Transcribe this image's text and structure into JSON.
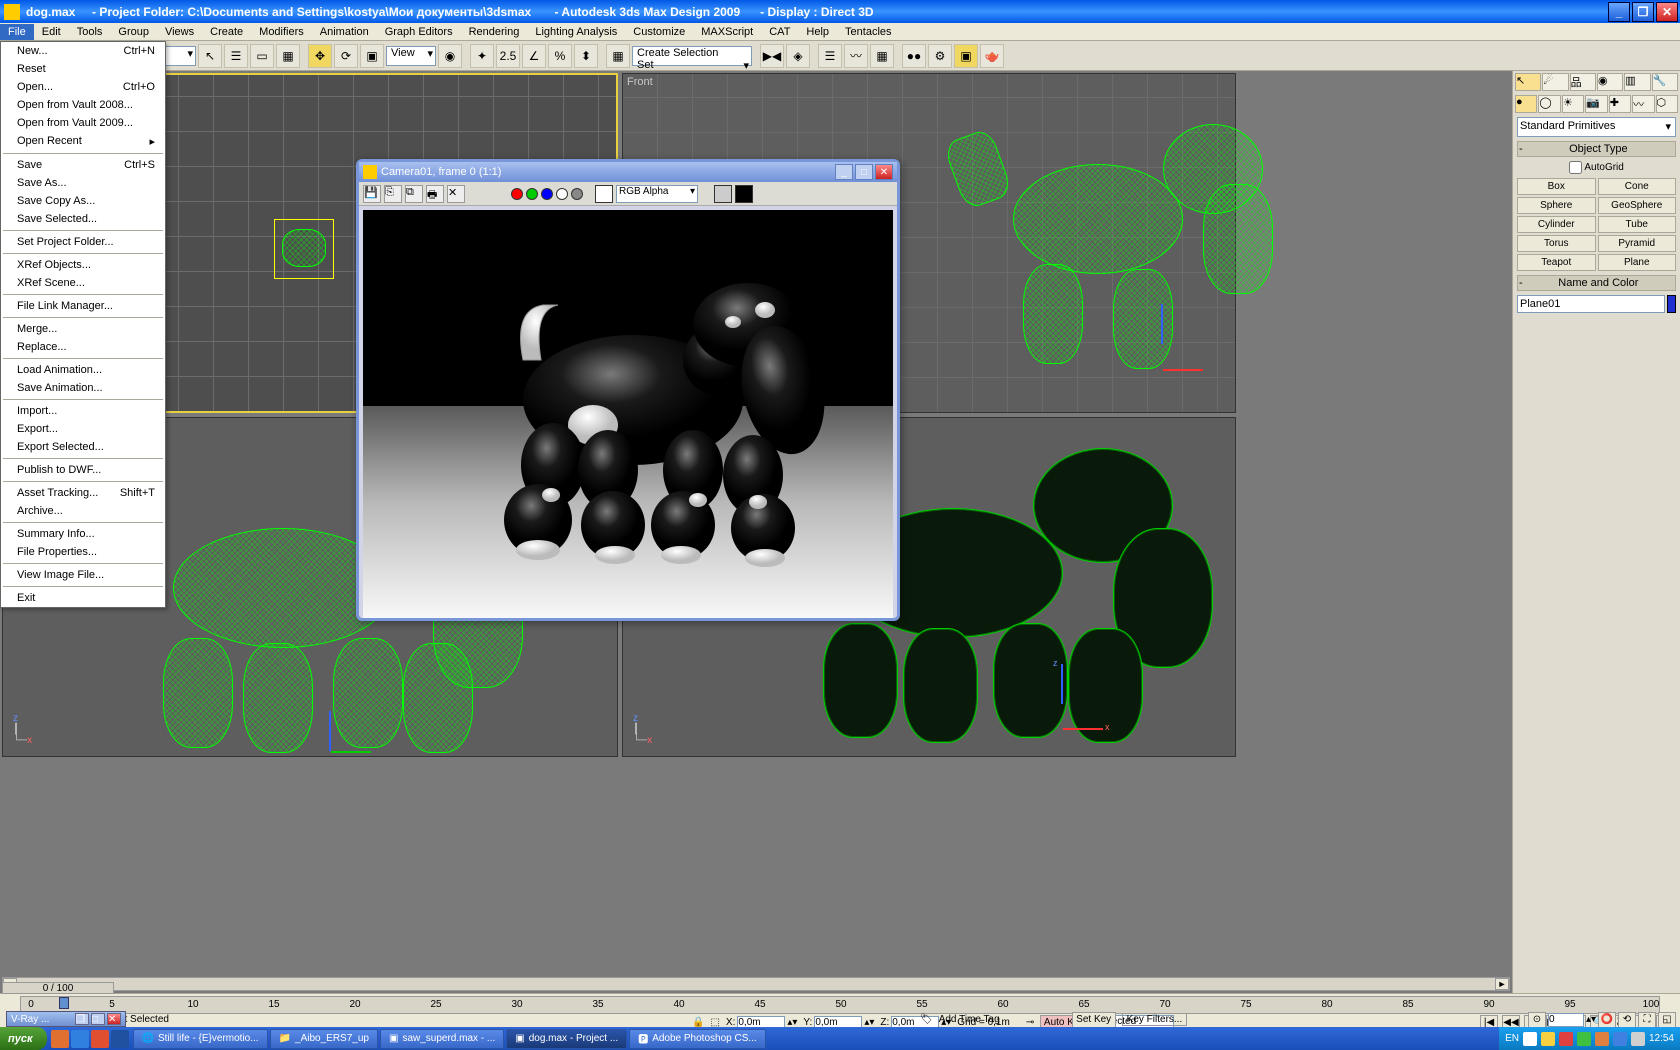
{
  "window": {
    "filename": "dog.max",
    "project_label": "- Project Folder: C:\\Documents and Settings\\kostya\\Мои документы\\3dsmax",
    "app": "- Autodesk 3ds Max Design 2009",
    "display": "- Display : Direct 3D"
  },
  "menubar": [
    "File",
    "Edit",
    "Tools",
    "Group",
    "Views",
    "Create",
    "Modifiers",
    "Animation",
    "Graph Editors",
    "Rendering",
    "Lighting Analysis",
    "Customize",
    "MAXScript",
    "CAT",
    "Help",
    "Tentacles"
  ],
  "file_menu": [
    {
      "label": "New...",
      "accel": "Ctrl+N"
    },
    {
      "label": "Reset"
    },
    {
      "label": "Open...",
      "accel": "Ctrl+O"
    },
    {
      "label": "Open from Vault 2008..."
    },
    {
      "label": "Open from Vault 2009..."
    },
    {
      "label": "Open Recent",
      "sub": true
    },
    {
      "sep": true
    },
    {
      "label": "Save",
      "accel": "Ctrl+S"
    },
    {
      "label": "Save As..."
    },
    {
      "label": "Save Copy As..."
    },
    {
      "label": "Save Selected..."
    },
    {
      "sep": true
    },
    {
      "label": "Set Project Folder..."
    },
    {
      "sep": true
    },
    {
      "label": "XRef Objects..."
    },
    {
      "label": "XRef Scene..."
    },
    {
      "sep": true
    },
    {
      "label": "File Link Manager..."
    },
    {
      "sep": true
    },
    {
      "label": "Merge..."
    },
    {
      "label": "Replace..."
    },
    {
      "sep": true
    },
    {
      "label": "Load Animation..."
    },
    {
      "label": "Save Animation..."
    },
    {
      "sep": true
    },
    {
      "label": "Import..."
    },
    {
      "label": "Export..."
    },
    {
      "label": "Export Selected..."
    },
    {
      "sep": true
    },
    {
      "label": "Publish to DWF..."
    },
    {
      "sep": true
    },
    {
      "label": "Asset Tracking...",
      "accel": "Shift+T"
    },
    {
      "label": "Archive..."
    },
    {
      "sep": true
    },
    {
      "label": "Summary Info..."
    },
    {
      "label": "File Properties..."
    },
    {
      "sep": true
    },
    {
      "label": "View Image File..."
    },
    {
      "sep": true
    },
    {
      "label": "Exit"
    }
  ],
  "toolbar": {
    "view_dropdown": "View",
    "snap_value": "2.5",
    "selection_set": "Create Selection Set"
  },
  "viewports": {
    "tl": "",
    "tr": "Front",
    "bl": "",
    "br": ""
  },
  "render_window": {
    "title": "Camera01, frame 0 (1:1)",
    "channel": "RGB Alpha"
  },
  "command_panel": {
    "category": "Standard Primitives",
    "object_type_header": "Object Type",
    "autogrid": "AutoGrid",
    "primitives": [
      [
        "Box",
        "Cone"
      ],
      [
        "Sphere",
        "GeoSphere"
      ],
      [
        "Cylinder",
        "Tube"
      ],
      [
        "Torus",
        "Pyramid"
      ],
      [
        "Teapot",
        "Plane"
      ]
    ],
    "name_color_header": "Name and Color",
    "object_name": "Plane01"
  },
  "timeline": {
    "frame": "0 / 100",
    "ticks": [
      0,
      5,
      10,
      15,
      20,
      25,
      30,
      35,
      40,
      45,
      50,
      55,
      60,
      65,
      70,
      75,
      80,
      85,
      90,
      95,
      100
    ],
    "status": "1 Object Selected",
    "x": "0,0m",
    "y": "0,0m",
    "z": "0,0m",
    "grid": "Grid = 0,1m",
    "auto_key": "Auto Key",
    "set_key": "Set Key",
    "key_mode": "Selected",
    "key_filters": "Key Filters...",
    "add_time_tag": "Add Time Tag",
    "frame_spinner": "0"
  },
  "vray": {
    "title": "V-Ray ..."
  },
  "taskbar": {
    "start": "пуск",
    "buttons": [
      "Still life - {E}vermotio...",
      "_Aibo_ERS7_up",
      "saw_superd.max  - ...",
      "dog.max   - Project ...",
      "Adobe Photoshop CS..."
    ],
    "lang": "EN",
    "clock": "12:54"
  }
}
